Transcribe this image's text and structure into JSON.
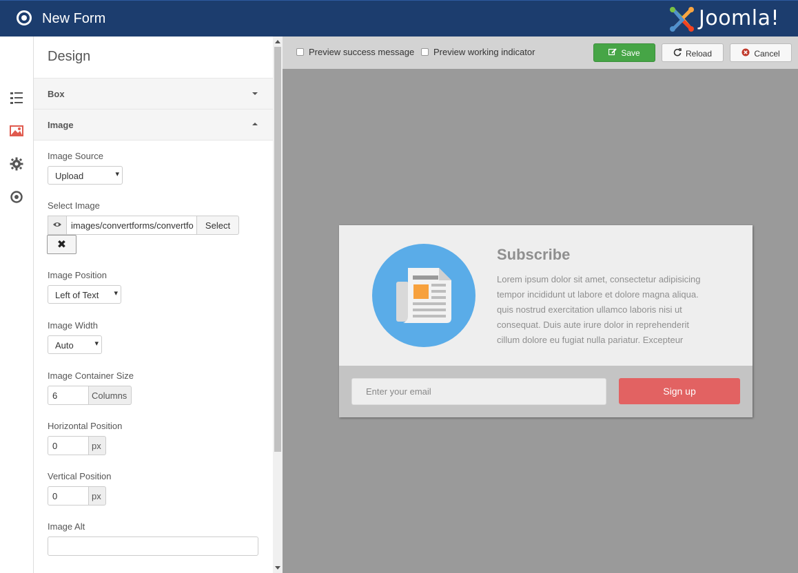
{
  "header": {
    "title": "New Form",
    "brand": "Joomla!"
  },
  "rail": {
    "items": [
      "list-icon",
      "image-icon",
      "gear-icon",
      "target-icon"
    ],
    "active_color": "#e05a4e"
  },
  "panel": {
    "title": "Design",
    "sections": {
      "box": "Box",
      "image": "Image"
    },
    "image_source": {
      "label": "Image Source",
      "value": "Upload"
    },
    "select_image": {
      "label": "Select Image",
      "value": "images/convertforms/convertfo",
      "button": "Select",
      "clear": "✖"
    },
    "image_position": {
      "label": "Image Position",
      "value": "Left of Text"
    },
    "image_width": {
      "label": "Image Width",
      "value": "Auto"
    },
    "container_size": {
      "label": "Image Container Size",
      "value": "6",
      "unit": "Columns"
    },
    "horizontal": {
      "label": "Horizontal Position",
      "value": "0",
      "unit": "px"
    },
    "vertical": {
      "label": "Vertical Position",
      "value": "0",
      "unit": "px"
    },
    "image_alt": {
      "label": "Image Alt",
      "value": ""
    }
  },
  "toolbar": {
    "preview_success": "Preview success message",
    "preview_working": "Preview working indicator",
    "save": "Save",
    "reload": "Reload",
    "cancel": "Cancel"
  },
  "preview": {
    "title": "Subscribe",
    "text": "Lorem ipsum dolor sit amet, consectetur adipisicing tempor incididunt ut labore et dolore magna aliqua. quis nostrud exercitation ullamco laboris nisi ut consequat. Duis aute irure dolor in reprehenderit cillum dolore eu fugiat nulla pariatur. Excepteur",
    "email_placeholder": "Enter your email",
    "button": "Sign up"
  },
  "colors": {
    "header": "#1c3d6e",
    "save": "#46a546",
    "signup": "#e26262",
    "circle": "#5aace8"
  }
}
